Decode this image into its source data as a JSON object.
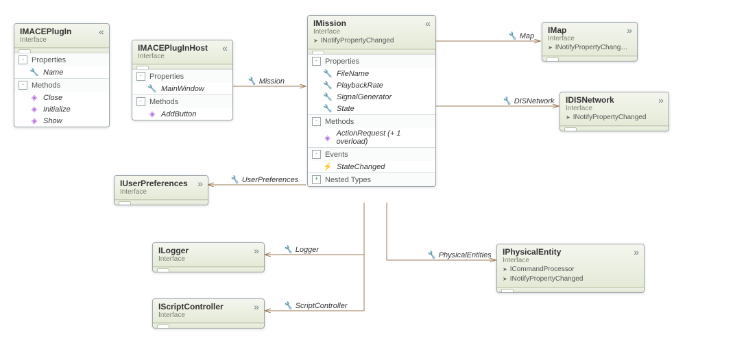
{
  "diagram": {
    "interfaces": {
      "imaceplugin": {
        "title": "IMACEPlugIn",
        "stereo": "Interface",
        "implements": [],
        "expanded": true,
        "sections": {
          "properties": {
            "label": "Properties",
            "state": "-",
            "items": [
              {
                "kind": "prop",
                "name": "Name"
              }
            ]
          },
          "methods": {
            "label": "Methods",
            "state": "-",
            "items": [
              {
                "kind": "meth",
                "name": "Close"
              },
              {
                "kind": "meth",
                "name": "Initialize"
              },
              {
                "kind": "meth",
                "name": "Show"
              }
            ]
          }
        }
      },
      "imacepluginhost": {
        "title": "IMACEPlugInHost",
        "stereo": "Interface",
        "implements": [],
        "expanded": true,
        "sections": {
          "properties": {
            "label": "Properties",
            "state": "-",
            "items": [
              {
                "kind": "prop",
                "name": "MainWindow"
              }
            ]
          },
          "methods": {
            "label": "Methods",
            "state": "-",
            "items": [
              {
                "kind": "meth",
                "name": "AddButton"
              }
            ]
          }
        }
      },
      "imission": {
        "title": "IMission",
        "stereo": "Interface",
        "implements": [
          "INotifyPropertyChanged"
        ],
        "expanded": true,
        "sections": {
          "properties": {
            "label": "Properties",
            "state": "-",
            "items": [
              {
                "kind": "prop",
                "name": "FileName"
              },
              {
                "kind": "prop",
                "name": "PlaybackRate"
              },
              {
                "kind": "prop",
                "name": "SignalGenerator"
              },
              {
                "kind": "prop",
                "name": "State"
              }
            ]
          },
          "methods": {
            "label": "Methods",
            "state": "-",
            "items": [
              {
                "kind": "meth",
                "name": "ActionRequest (+ 1 overload)"
              }
            ]
          },
          "events": {
            "label": "Events",
            "state": "-",
            "items": [
              {
                "kind": "evt",
                "name": "StateChanged"
              }
            ]
          },
          "nested": {
            "label": "Nested Types",
            "state": "+",
            "items": []
          }
        }
      },
      "imap": {
        "title": "IMap",
        "stereo": "Interface",
        "implements": [
          "INotifyPropertyChang…"
        ],
        "expanded": false
      },
      "idisnetwork": {
        "title": "IDISNetwork",
        "stereo": "Interface",
        "implements": [
          "INotifyPropertyChanged"
        ],
        "expanded": false
      },
      "iuserpreferences": {
        "title": "IUserPreferences",
        "stereo": "Interface",
        "implements": [],
        "expanded": false
      },
      "ilogger": {
        "title": "ILogger",
        "stereo": "Interface",
        "implements": [],
        "expanded": false
      },
      "iscriptcontroller": {
        "title": "IScriptController",
        "stereo": "Interface",
        "implements": [],
        "expanded": false
      },
      "iphysicalentity": {
        "title": "IPhysicalEntity",
        "stereo": "Interface",
        "implements": [
          "ICommandProcessor",
          "INotifyPropertyChanged"
        ],
        "expanded": false
      }
    },
    "associations": {
      "mission": {
        "label": "Mission"
      },
      "map": {
        "label": "Map"
      },
      "disnetwork": {
        "label": "DISNetwork"
      },
      "userpreferences": {
        "label": "UserPreferences"
      },
      "logger": {
        "label": "Logger"
      },
      "scriptcontroller": {
        "label": "ScriptController"
      },
      "physicalentities": {
        "label": "PhysicalEntities"
      }
    }
  }
}
